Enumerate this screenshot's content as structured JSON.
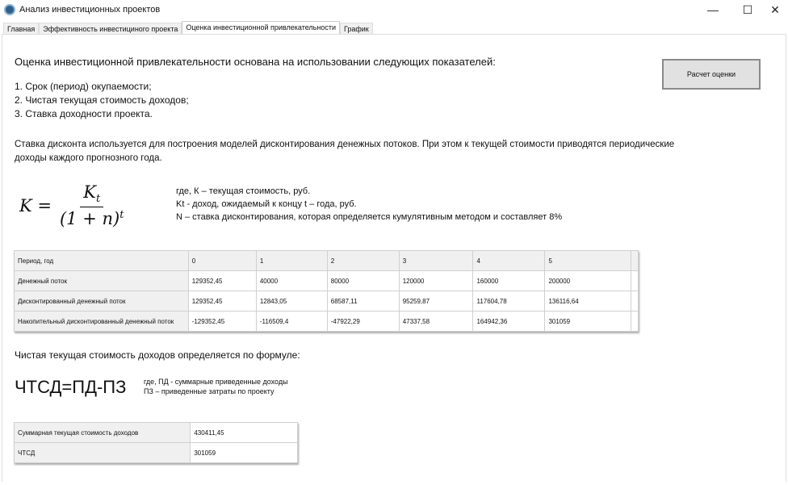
{
  "window": {
    "title": "Анализ инвестиционных проектов",
    "minimize": "—",
    "maximize": "☐",
    "close": "✕"
  },
  "tabs": [
    {
      "label": "Главная"
    },
    {
      "label": "Эффективность инвестициного проекта"
    },
    {
      "label": "Оценка инвестиционной привлекательности"
    },
    {
      "label": "График"
    }
  ],
  "intro": "Оценка инвестиционной привлекательности основана на использовании следующих показателей:",
  "indicators": [
    "1. Срок (период) окупаемости;",
    "2. Чистая текущая стоимость доходов;",
    "3. Ставка доходности проекта."
  ],
  "calc_button": "Расчет оценки",
  "discount_text": "Ставка дисконта используется для построения моделей дисконтирования денежных потоков. При этом к текущей стоимости приводятся периодические доходы каждого прогнозного года.",
  "formula": {
    "lhs": "K =",
    "num": "Kt",
    "den": "(1 + n)t"
  },
  "legend": [
    "где, К – текущая стоимость, руб.",
    "Kt  - доход, ожидаемый к концу t – года, руб.",
    "N – ставка дисконтирования, которая определяется кумулятивным методом и составляет 8%"
  ],
  "table": {
    "rows": [
      [
        "Период, год",
        "0",
        "1",
        "2",
        "3",
        "4",
        "5"
      ],
      [
        "Денежный поток",
        "129352,45",
        "40000",
        "80000",
        "120000",
        "160000",
        "200000"
      ],
      [
        "Дисконтированный денежный поток",
        "129352,45",
        "12843,05",
        "68587,11",
        "95259,87",
        "117604,78",
        "136116,64"
      ],
      [
        "Накопительный дисконтированный денежный поток",
        "-129352,45",
        "-116509,4",
        "-47922,29",
        "47337,58",
        "164942,36",
        "301059"
      ]
    ]
  },
  "npv_text": "Чистая текущая стоимость  доходов определяется по формуле:",
  "npv_formula": "ЧТСД=ПД-ПЗ",
  "npv_legend": [
    "где, ПД - суммарные приведенные доходы",
    "ПЗ – приведенные затраты по проекту"
  ],
  "summary": [
    [
      "Суммарная текущая стоимость доходов",
      "430411,45"
    ],
    [
      "ЧТСД",
      "301059"
    ]
  ]
}
